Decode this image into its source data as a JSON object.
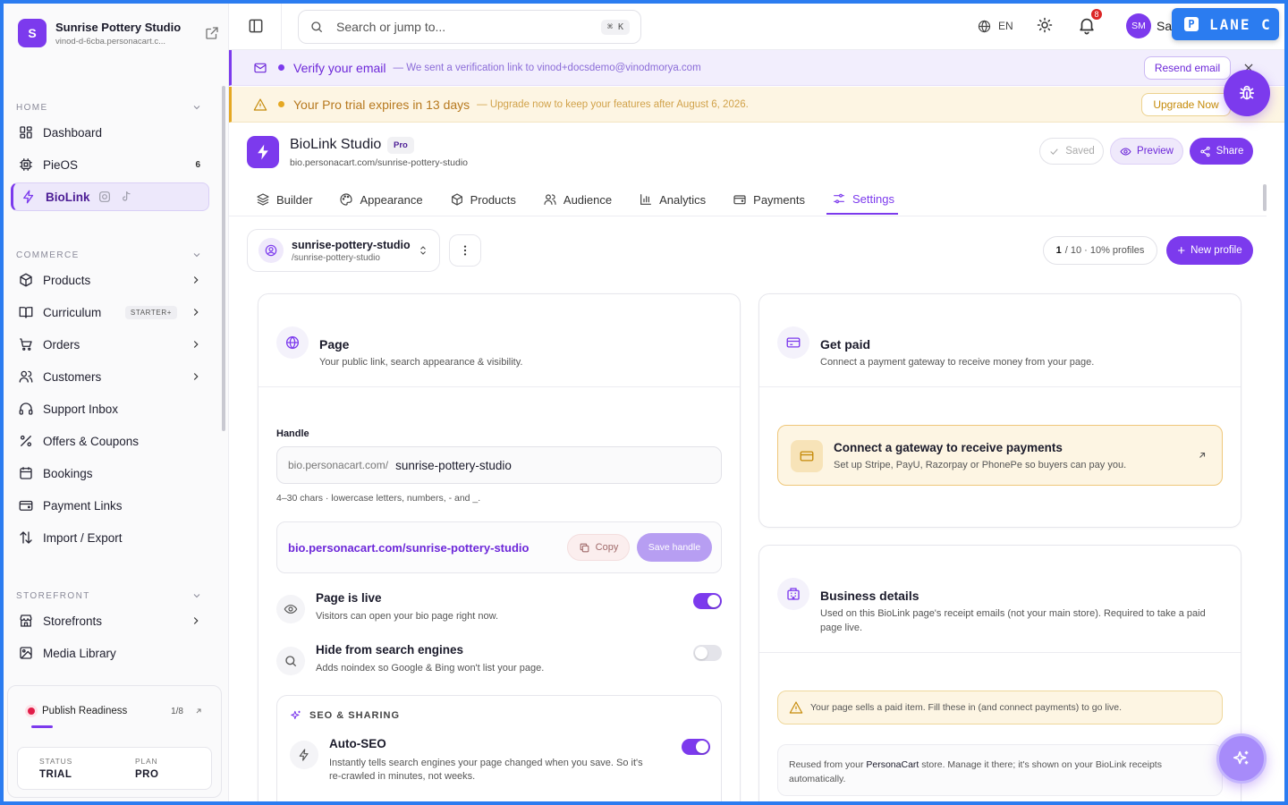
{
  "sidebar": {
    "brand": {
      "initial": "S",
      "name": "Sunrise Pottery Studio",
      "url": "vinod-d-6cba.personacart.c..."
    },
    "sections": {
      "home": "HOME",
      "commerce": "COMMERCE",
      "storefront": "STOREFRONT"
    },
    "home_items": [
      {
        "label": "Dashboard"
      },
      {
        "label": "PieOS",
        "count": "6"
      },
      {
        "label": "BioLink"
      }
    ],
    "commerce_items": [
      {
        "label": "Products"
      },
      {
        "label": "Curriculum",
        "badge": "STARTER+"
      },
      {
        "label": "Orders"
      },
      {
        "label": "Customers"
      },
      {
        "label": "Support Inbox"
      },
      {
        "label": "Offers & Coupons"
      },
      {
        "label": "Bookings"
      },
      {
        "label": "Payment Links"
      },
      {
        "label": "Import / Export"
      }
    ],
    "storefront_items": [
      {
        "label": "Storefronts"
      },
      {
        "label": "Media Library"
      }
    ],
    "publish_readiness": {
      "label": "Publish Readiness",
      "count": "1/8",
      "progress": 0.125,
      "status_label": "STATUS",
      "status_value": "TRIAL",
      "plan_label": "PLAN",
      "plan_value": "PRO"
    }
  },
  "topbar": {
    "search_placeholder": "Search or jump to...",
    "search_shortcut": "⌘ K",
    "language": "EN",
    "notifications_count": "8",
    "avatar_initials": "SM",
    "user_name": "Sa",
    "lane_label": "LANE C"
  },
  "banners": {
    "verify": {
      "title": "Verify your email",
      "sub": "We sent a verification link to vinod+docsdemo@vinodmorya.com",
      "button": "Resend email"
    },
    "trial": {
      "title": "Your Pro trial expires in 13 days",
      "sub": "Upgrade now to keep your features after August 6, 2026.",
      "button": "Upgrade Now"
    }
  },
  "page": {
    "title": "BioLink Studio",
    "plan_badge": "Pro",
    "url": "bio.personacart.com/sunrise-pottery-studio",
    "saved_label": "Saved",
    "preview_label": "Preview",
    "share_label": "Share"
  },
  "tabs": [
    {
      "label": "Builder"
    },
    {
      "label": "Appearance"
    },
    {
      "label": "Products"
    },
    {
      "label": "Audience"
    },
    {
      "label": "Analytics"
    },
    {
      "label": "Payments"
    },
    {
      "label": "Settings"
    }
  ],
  "profile": {
    "name": "sunrise-pottery-studio",
    "path": "/sunrise-pottery-studio",
    "count_current": "1",
    "count_rest": "/ 10 · 10%  profiles",
    "new_label": "New profile"
  },
  "page_card": {
    "title": "Page",
    "subtitle": "Your public link, search appearance & visibility.",
    "handle_label": "Handle",
    "handle_prefix": "bio.personacart.com/",
    "handle_value": "sunrise-pottery-studio",
    "handle_hint": "4–30 chars · lowercase letters, numbers, - and _.",
    "full_link": "bio.personacart.com/sunrise-pottery-studio",
    "copy_label": "Copy",
    "save_handle_label": "Save handle",
    "live_title": "Page is live",
    "live_sub": "Visitors can open your bio page right now.",
    "live_on": true,
    "hide_title": "Hide from search engines",
    "hide_sub": "Adds noindex so Google & Bing won't list your page.",
    "hide_on": false,
    "seo_header": "SEO & SHARING",
    "autoseo_title": "Auto-SEO",
    "autoseo_sub": "Instantly tells search engines your page changed when you save. So it's re-crawled in minutes, not weeks.",
    "autoseo_on": true
  },
  "paid_card": {
    "title": "Get paid",
    "subtitle": "Connect a payment gateway to receive money from your page.",
    "gateway_title": "Connect a gateway to receive payments",
    "gateway_sub": "Set up Stripe, PayU, Razorpay or PhonePe so buyers can pay you."
  },
  "business_card": {
    "title": "Business details",
    "subtitle": "Used on this BioLink page's receipt emails (not your main store). Required to take a paid page live.",
    "warning": "Your page sells a paid item. Fill these in (and connect payments) to go live.",
    "reuse_before": "Reused from your ",
    "reuse_brand": "PersonaCart",
    "reuse_after": " store. Manage it there; it's shown on your BioLink receipts automatically."
  }
}
